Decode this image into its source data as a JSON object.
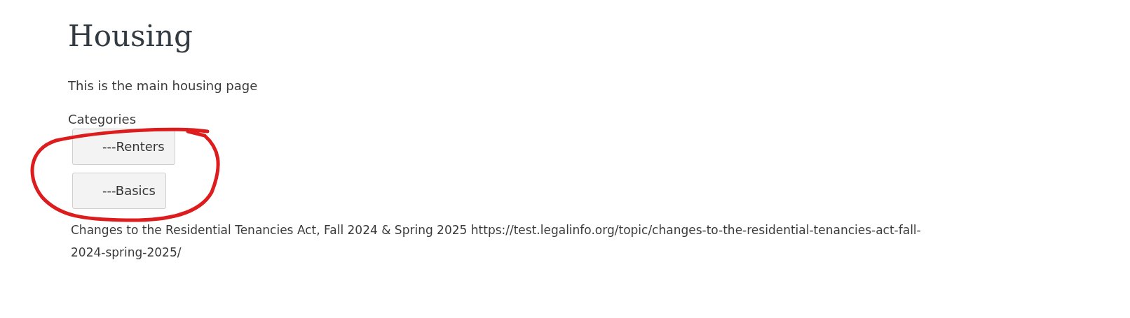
{
  "title": "Housing",
  "intro": "This is the main housing page",
  "categories_label": "Categories",
  "category_buttons": [
    {
      "label": "---Renters"
    },
    {
      "label": "---Basics"
    }
  ],
  "topic_link": "Changes to the Residential Tenancies Act, Fall 2024 & Spring 2025 https://test.legalinfo.org/topic/changes-to-the-residential-tenancies-act-fall-2024-spring-2025/"
}
